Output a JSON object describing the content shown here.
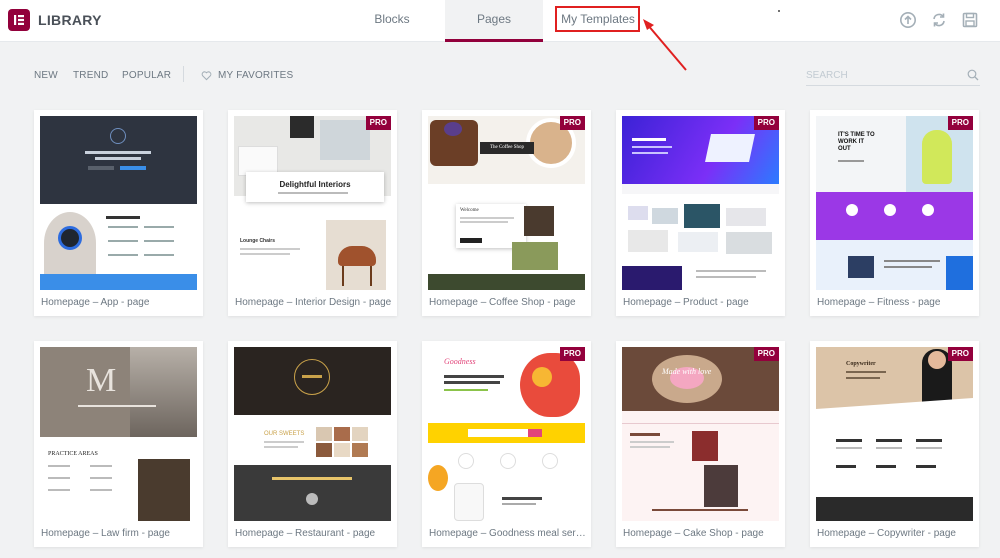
{
  "header": {
    "title": "LIBRARY",
    "tabs": [
      {
        "label": "Blocks"
      },
      {
        "label": "Pages"
      },
      {
        "label": "My Templates"
      }
    ]
  },
  "filters": {
    "items": [
      "NEW",
      "TREND",
      "POPULAR"
    ],
    "favorites": "MY FAVORITES",
    "search_placeholder": "SEARCH"
  },
  "colors": {
    "brand": "#92003b",
    "highlight": "#e02020",
    "pro_badge": "#93003c"
  },
  "cards": [
    {
      "label": "Homepage – App - page",
      "pro": false
    },
    {
      "label": "Homepage – Interior Design - page",
      "pro": true,
      "badge": "PRO",
      "thumb_heading": "Delightful Interiors",
      "thumb_sub": "Lounge Chairs"
    },
    {
      "label": "Homepage – Coffee Shop - page",
      "pro": true,
      "badge": "PRO",
      "thumb_heading": "The Coffee Shop",
      "thumb_sub": "Welcome"
    },
    {
      "label": "Homepage – Product - page",
      "pro": true,
      "badge": "PRO"
    },
    {
      "label": "Homepage – Fitness - page",
      "pro": true,
      "badge": "PRO",
      "thumb_heading": "IT'S TIME TO WORK IT OUT"
    },
    {
      "label": "Homepage – Law firm - page",
      "pro": false,
      "thumb_heading": "M",
      "thumb_sub": "PRACTICE AREAS"
    },
    {
      "label": "Homepage – Restaurant - page",
      "pro": false,
      "thumb_heading": "OUR SWEETS"
    },
    {
      "label": "Homepage – Goodness meal serv...",
      "pro": true,
      "badge": "PRO",
      "thumb_heading": "Goodness"
    },
    {
      "label": "Homepage – Cake Shop - page",
      "pro": true,
      "badge": "PRO",
      "thumb_heading": "Made with love"
    },
    {
      "label": "Homepage – Copywriter - page",
      "pro": true,
      "badge": "PRO",
      "thumb_heading": "Copywriter"
    }
  ]
}
